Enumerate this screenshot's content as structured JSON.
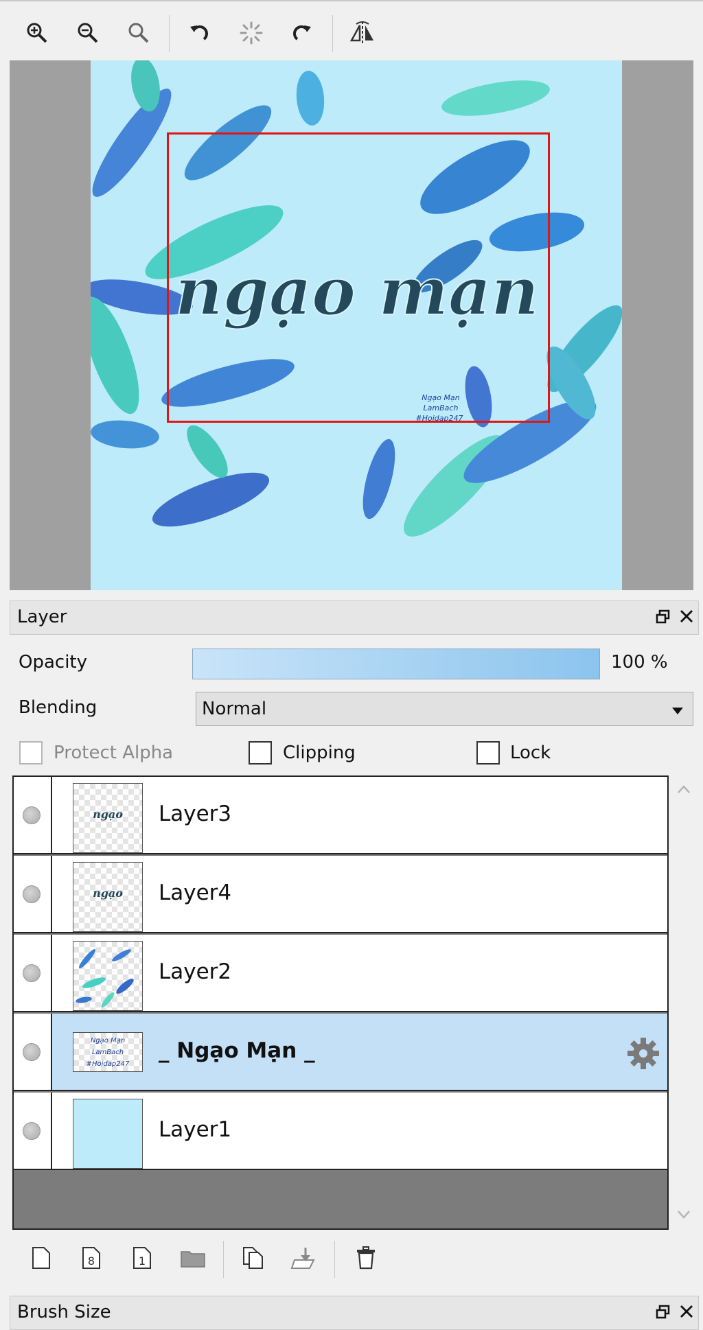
{
  "navigator": {
    "toolbar": {
      "icons": [
        "zoom-in-icon",
        "zoom-out-icon",
        "zoom-reset-icon",
        "rotate-left-icon",
        "rotate-reset-icon",
        "rotate-right-icon",
        "flip-horizontal-icon"
      ]
    },
    "artwork_text": {
      "main": "ngạo mạn",
      "signature_lines": [
        "Ngạo Mạn",
        "LamBach",
        "#Hoidap247"
      ]
    }
  },
  "layer_panel": {
    "title": "Layer",
    "opacity_label": "Opacity",
    "opacity_value": "100 %",
    "opacity_fraction": 1.0,
    "blending_label": "Blending",
    "blending_value": "Normal",
    "protect_alpha_label": "Protect Alpha",
    "clipping_label": "Clipping",
    "lock_label": "Lock",
    "layers": [
      {
        "name": "Layer3",
        "selected": false
      },
      {
        "name": "Layer4",
        "selected": false
      },
      {
        "name": "Layer2",
        "selected": false
      },
      {
        "name": "_ Ngạo Mạn _",
        "selected": true
      },
      {
        "name": "Layer1",
        "selected": false
      }
    ],
    "actions": [
      "new-layer-icon",
      "new-8bit-layer-icon",
      "new-1bit-layer-icon",
      "new-folder-icon",
      "duplicate-layer-icon",
      "merge-down-icon",
      "delete-layer-icon"
    ]
  },
  "brush_panel": {
    "title": "Brush Size"
  },
  "colors": {
    "selection": "#c3e0f7",
    "art_bg": "#bdebfa",
    "view_rect": "#e31414"
  }
}
